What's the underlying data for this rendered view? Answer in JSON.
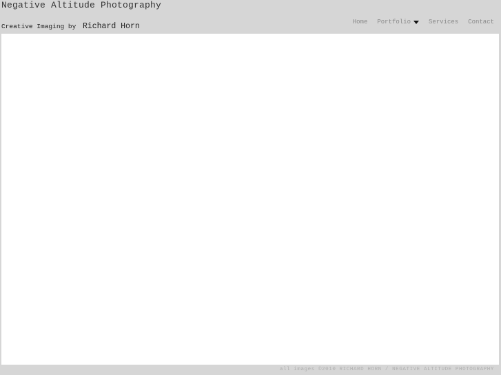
{
  "header": {
    "site_title": "Negative Altitude Photography",
    "tagline_prefix": "Creative Imaging by",
    "tagline_name": "Richard Horn"
  },
  "nav": {
    "items": [
      {
        "label": "Home",
        "icon": null
      },
      {
        "label": "Portfolio",
        "icon": "caret-down-icon"
      },
      {
        "label": "Services",
        "icon": null
      },
      {
        "label": "Contact",
        "icon": null
      }
    ]
  },
  "footer": {
    "text": "all images ©2010 RICHARD HORN / NEGATIVE ALTITUDE PHOTOGRAPHY"
  }
}
